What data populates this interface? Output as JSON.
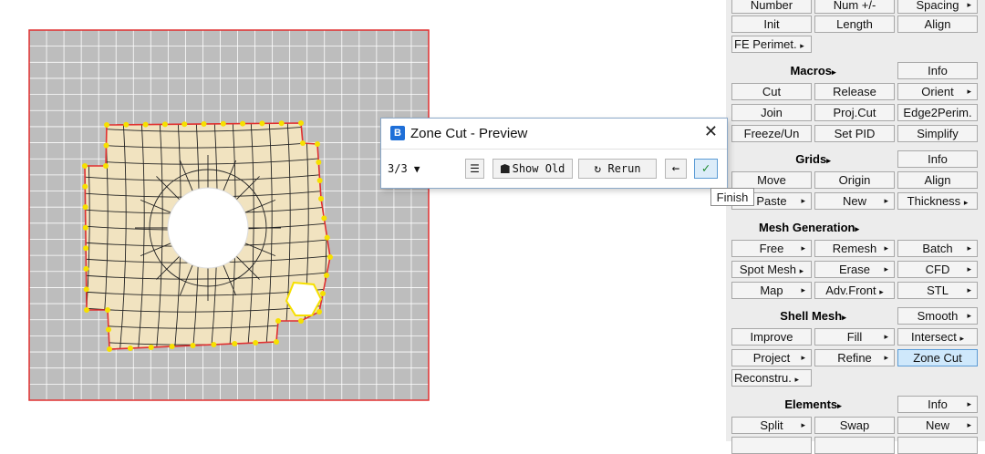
{
  "dialog": {
    "title": "Zone Cut - Preview",
    "app_icon_letter": "B",
    "close_glyph": "✕",
    "step": "3/3",
    "step_caret": "▼",
    "menu_glyph": "☰",
    "show_old_label": "Show Old",
    "rerun_label": "Rerun",
    "back_glyph": "←",
    "finish_glyph": "✓",
    "finish_tooltip": "Finish"
  },
  "panel": {
    "row_top": {
      "number": "Number",
      "num_pm": "Num +/-",
      "spacing": "Spacing"
    },
    "row_init": {
      "init": "Init",
      "length": "Length",
      "align": "Align"
    },
    "fe_perimet": "FE Perimet.",
    "macros": {
      "title": "Macros",
      "info": "Info",
      "cut": "Cut",
      "release": "Release",
      "orient": "Orient",
      "join": "Join",
      "proj_cut": "Proj.Cut",
      "edge2perim": "Edge2Perim.",
      "freeze_un": "Freeze/Un",
      "set_pid": "Set PID",
      "simplify": "Simplify"
    },
    "grids": {
      "title": "Grids",
      "info": "Info",
      "move": "Move",
      "origin": "Origin",
      "align": "Align",
      "paste": "Paste",
      "new": "New",
      "thickness": "Thickness"
    },
    "mesh_generation": {
      "title": "Mesh Generation",
      "free": "Free",
      "remesh": "Remesh",
      "batch": "Batch",
      "spot_mesh": "Spot Mesh",
      "erase": "Erase",
      "cfd": "CFD",
      "map": "Map",
      "adv_front": "Adv.Front",
      "stl": "STL"
    },
    "shell_mesh": {
      "title": "Shell Mesh",
      "smooth": "Smooth",
      "improve": "Improve",
      "fill": "Fill",
      "intersect": "Intersect",
      "project": "Project",
      "refine": "Refine",
      "zone_cut": "Zone Cut",
      "reconstru": "Reconstru."
    },
    "elements": {
      "title": "Elements",
      "info": "Info",
      "split": "Split",
      "swap": "Swap",
      "new": "New"
    },
    "arrow": "▸"
  },
  "colors": {
    "grid_bg": "#bdbdbd",
    "grid_line": "#ffffff",
    "frame": "#e03030",
    "zone_fill": "#f1e3c0",
    "zone_line": "#222222",
    "node": "#f6e000",
    "accent": "#5b9bd5"
  },
  "icons": [
    "app-icon",
    "close-icon",
    "menu-icon",
    "show-old-icon",
    "rerun-icon",
    "back-arrow-icon",
    "checkmark-icon",
    "submenu-arrow-icon"
  ]
}
